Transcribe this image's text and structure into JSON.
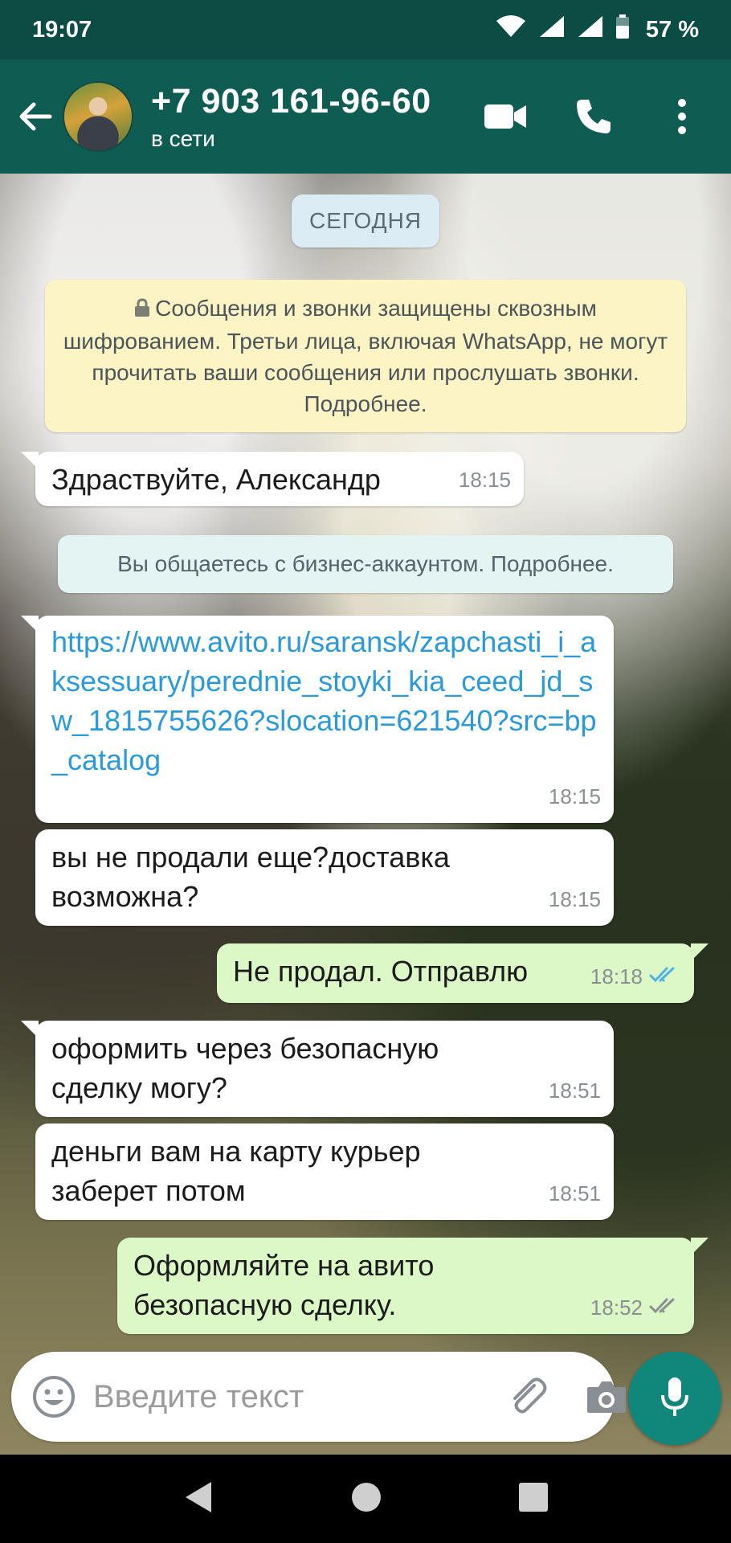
{
  "status_bar": {
    "time": "19:07",
    "battery": "57 %"
  },
  "header": {
    "contact_name": "+7 903 161-96-60",
    "status": "в сети",
    "icons": [
      "back-arrow-icon",
      "video-call-icon",
      "voice-call-icon",
      "more-vert-icon"
    ]
  },
  "chat": {
    "date_label": "СЕГОДНЯ",
    "encryption_notice": "Сообщения и звонки защищены сквозным шифрованием. Третьи лица, включая WhatsApp, не могут прочитать ваши сообщения или прослушать звонки. Подробнее.",
    "business_notice": "Вы общаетесь с бизнес-аккаунтом. Подробнее.",
    "messages": [
      {
        "direction": "in",
        "text": "Здраствуйте, Александр",
        "time": "18:15"
      },
      {
        "direction": "in",
        "text": "https://www.avito.ru/saransk/zapchasti_i_aksessuary/perednie_stoyki_kia_ceed_jd_sw_1815755626?slocation=621540?src=bp_catalog",
        "time": "18:15",
        "is_link": true
      },
      {
        "direction": "in",
        "text": "вы не продали еще?доставка возможна?",
        "time": "18:15"
      },
      {
        "direction": "out",
        "text": "Не продал. Отправлю",
        "time": "18:18",
        "ticks": "read"
      },
      {
        "direction": "in",
        "text": "оформить через безопасную сделку могу?",
        "time": "18:51"
      },
      {
        "direction": "in",
        "text": "деньги вам на карту курьер заберет потом",
        "time": "18:51"
      },
      {
        "direction": "out",
        "text": "Оформляйте на авито безопасную сделку.",
        "time": "18:52",
        "ticks": "delivered"
      }
    ]
  },
  "composer": {
    "placeholder": "Введите текст"
  },
  "colors": {
    "header": "#0e5c52",
    "status_bar": "#0b4d45",
    "outgoing_bubble": "#dcf8c6",
    "incoming_bubble": "#ffffff",
    "link": "#2c9ad8",
    "read_ticks": "#4fb3e8",
    "mic_button": "#11867a"
  }
}
